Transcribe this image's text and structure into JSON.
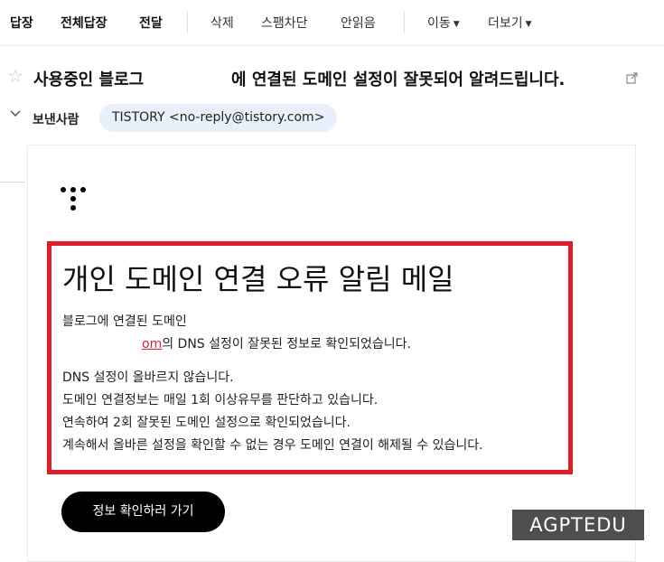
{
  "toolbar": {
    "reply": "답장",
    "reply_all": "전체답장",
    "forward": "전달",
    "delete": "삭제",
    "spam_block": "스팸차단",
    "mark_unread": "안읽음",
    "move": "이동",
    "more": "더보기"
  },
  "mail": {
    "subject_part1": "사용중인 블로그",
    "subject_part2": "에 연결된 도메인 설정이 잘못되어 알려드립니다.",
    "sender_label": "보낸사람",
    "sender_value": "TISTORY <no-reply@tistory.com>"
  },
  "body": {
    "title": "개인 도메인 연결 오류 알림 메일",
    "line1": "블로그에 연결된 도메인",
    "domain_link": "om",
    "line2_rest": "의 DNS 설정이 잘못된 정보로 확인되었습니다.",
    "lines": [
      "DNS 설정이 올바르지 않습니다.",
      "도메인 연결정보는 매일 1회 이상유무를 판단하고 있습니다.",
      "연속하여 2회 잘못된 도메인 설정으로 확인되었습니다.",
      "계속해서 올바른 설정을 확인할 수 없는 경우 도메인 연결이 해제될 수 있습니다."
    ],
    "cta_label": "정보 확인하러 가기"
  },
  "watermark": "AGPTEDU",
  "colors": {
    "alert_border": "#e11d2a",
    "sender_chip": "#e8f1fb",
    "button": "#000000"
  },
  "icons": {
    "star": "star-icon",
    "external": "external-link-icon",
    "chevron": "chevron-down-icon",
    "logo": "tistory-logo-icon"
  }
}
